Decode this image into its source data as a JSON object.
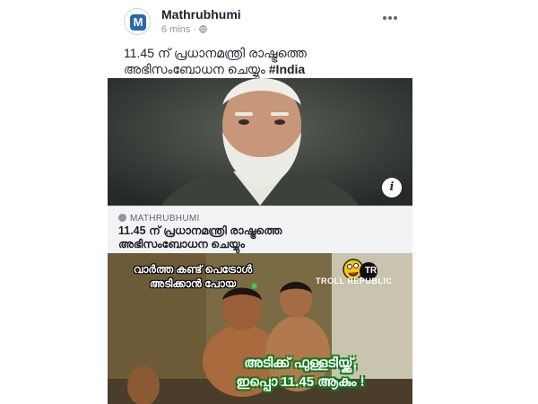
{
  "post": {
    "page_name": "Mathrubhumi",
    "timestamp": "6 mins",
    "visibility_icon": "globe-icon",
    "more_icon": "more-icon",
    "caption": "11.45 ന് പ്രധാനമന്ത്രി രാഷ്ട്രത്തെ അഭിസംബോധന ചെയ്യും",
    "hashtag": "#India"
  },
  "avatar": {
    "letter": "M",
    "color": "#2a6aa8"
  },
  "link_preview": {
    "domain": "MATHRUBHUMI",
    "title": "11.45 ന് പ്രധാനമന്ത്രി രാഷ്ട്രത്തെ അഭിസംബോധന ചെയ്യും",
    "info_icon": "i"
  },
  "meme": {
    "top_text": "വാർത്ത കണ്ട് പെട്രോൾ അടിക്കാൻ പോയ",
    "asterisk": "*",
    "bottom_line1": "അടിക്ക് ഫുള്ളടിയ്ക്ക്,",
    "bottom_line2": "ഇപ്പൊ 11.45 ആകും !",
    "logo_text": "TR",
    "brand": "TROLL REPUBLIC"
  }
}
